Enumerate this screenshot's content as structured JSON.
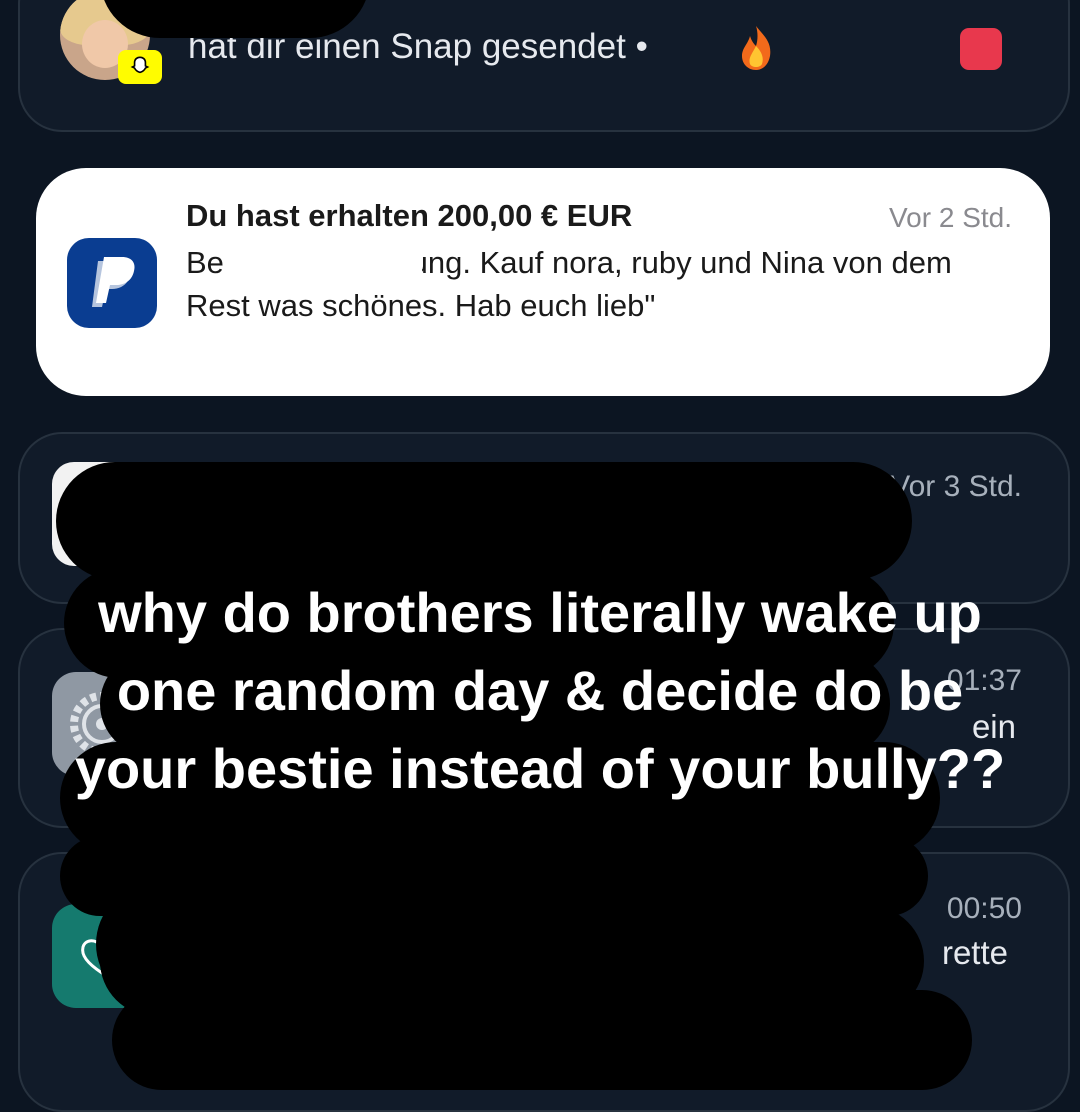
{
  "notifications": {
    "snap": {
      "text": "hat dir einen Snap gesendet •",
      "fire_emoji": "🔥"
    },
    "paypal": {
      "title": "Du hast erhalten 200,00 € EUR",
      "time": "Vor 2 Std.",
      "body": "Be            g: \"Arztrechnung.   Kauf nora, ruby und Nina von dem Rest was schönes.   Hab euch lieb\""
    },
    "n3": {
      "time": "Vor 3 Std."
    },
    "n4": {
      "time": "01:37",
      "snippet": "ein"
    },
    "n5": {
      "time": "00:50",
      "snippet": "rette"
    }
  },
  "overlay": {
    "caption": "why do brothers literally wake up one random day & decide do be your bestie instead of your bully??"
  },
  "colors": {
    "background": "#0c1522",
    "paypal_blue": "#0a3d91",
    "snap_yellow": "#fffc00",
    "red_square": "#e8384d"
  }
}
